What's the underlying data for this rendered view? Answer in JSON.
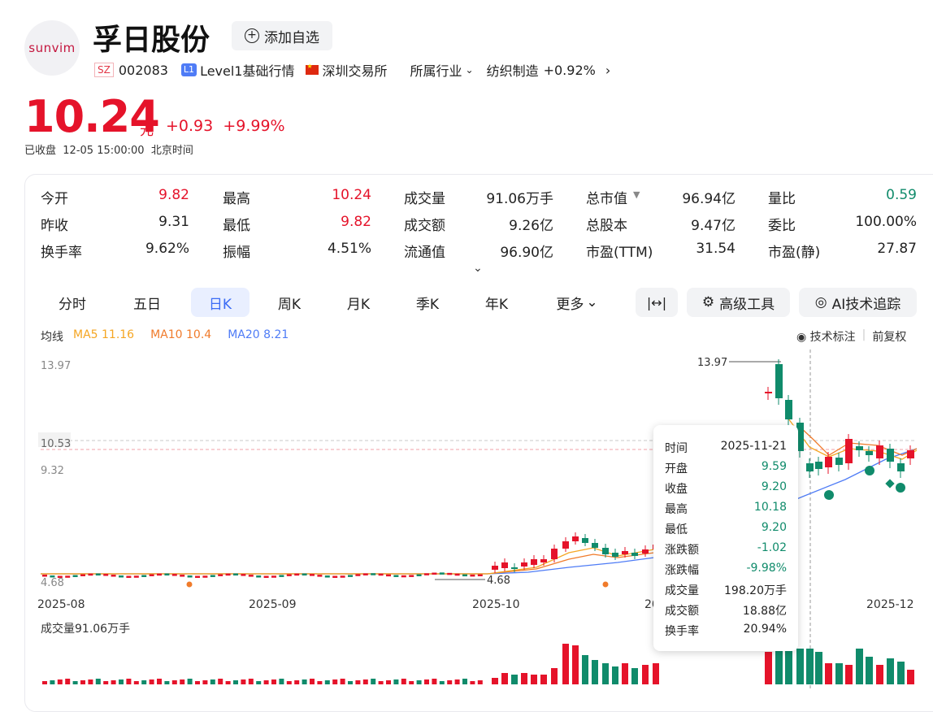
{
  "header": {
    "logo_text": "sunvim",
    "stock_name": "孚日股份",
    "add_watch_label": "添加自选",
    "market_tag": "SZ",
    "code": "002083",
    "level_tag": "L1",
    "level_label": "Level1基础行情",
    "exchange": "深圳交易所",
    "industry_label": "所属行业",
    "industry_name": "纺织制造",
    "industry_change": "+0.92%"
  },
  "quote": {
    "price": "10.24",
    "unit": "元",
    "change": "+0.93",
    "change_pct": "+9.99%",
    "status": "已收盘",
    "time": "12-05 15:00:00",
    "timezone": "北京时间"
  },
  "stats": [
    [
      {
        "label": "今开",
        "value": "9.82",
        "color": "red"
      },
      {
        "label": "最高",
        "value": "10.24",
        "color": "red"
      },
      {
        "label": "成交量",
        "value": "91.06万手",
        "color": ""
      },
      {
        "label": "总市值",
        "value": "96.94亿",
        "color": "",
        "dropdown": true
      },
      {
        "label": "量比",
        "value": "0.59",
        "color": "green"
      }
    ],
    [
      {
        "label": "昨收",
        "value": "9.31",
        "color": ""
      },
      {
        "label": "最低",
        "value": "9.82",
        "color": "red"
      },
      {
        "label": "成交额",
        "value": "9.26亿",
        "color": ""
      },
      {
        "label": "总股本",
        "value": "9.47亿",
        "color": ""
      },
      {
        "label": "委比",
        "value": "100.00%",
        "color": ""
      }
    ],
    [
      {
        "label": "换手率",
        "value": "9.62%",
        "color": ""
      },
      {
        "label": "振幅",
        "value": "4.51%",
        "color": ""
      },
      {
        "label": "流通值",
        "value": "96.90亿",
        "color": ""
      },
      {
        "label": "市盈(TTM)",
        "value": "31.54",
        "color": ""
      },
      {
        "label": "市盈(静)",
        "value": "27.87",
        "color": ""
      }
    ]
  ],
  "tabs": [
    "分时",
    "五日",
    "日K",
    "周K",
    "月K",
    "季K",
    "年K",
    "更多"
  ],
  "active_tab": "日K",
  "tools": {
    "fit_icon": "fit-width-icon",
    "advanced": "高级工具",
    "ai": "AI技术追踪"
  },
  "ma": {
    "label": "均线",
    "ma5": "MA5 11.16",
    "ma10": "MA10 10.4",
    "ma20": "MA20 8.21"
  },
  "chart_options": {
    "tech_label": "技术标注",
    "adjust_label": "前复权"
  },
  "chart": {
    "y_max_label": "13.97",
    "y_mid_label": "10.53",
    "y_low_label": "9.32",
    "y_min_label": "4.68",
    "high_marker": "13.97",
    "low_marker": "4.68",
    "x_labels": [
      "2025-08",
      "2025-09",
      "2025-10",
      "20",
      "2025-12"
    ],
    "volume_label": "成交量91.06万手"
  },
  "tooltip": [
    {
      "label": "时间",
      "value": "2025-11-21",
      "color": ""
    },
    {
      "label": "开盘",
      "value": "9.59",
      "color": "green"
    },
    {
      "label": "收盘",
      "value": "9.20",
      "color": "green"
    },
    {
      "label": "最高",
      "value": "10.18",
      "color": "green"
    },
    {
      "label": "最低",
      "value": "9.20",
      "color": "green"
    },
    {
      "label": "涨跌额",
      "value": "-1.02",
      "color": "green"
    },
    {
      "label": "涨跌幅",
      "value": "-9.98%",
      "color": "green"
    },
    {
      "label": "成交量",
      "value": "198.20万手",
      "color": ""
    },
    {
      "label": "成交额",
      "value": "18.88亿",
      "color": ""
    },
    {
      "label": "换手率",
      "value": "20.94%",
      "color": ""
    }
  ],
  "colors": {
    "up": "#e5132a",
    "down": "#108b6b",
    "ma5": "#f5a623",
    "ma10": "#f07b2b",
    "ma20": "#4f7cf6",
    "accent": "#3b6cf5"
  }
}
